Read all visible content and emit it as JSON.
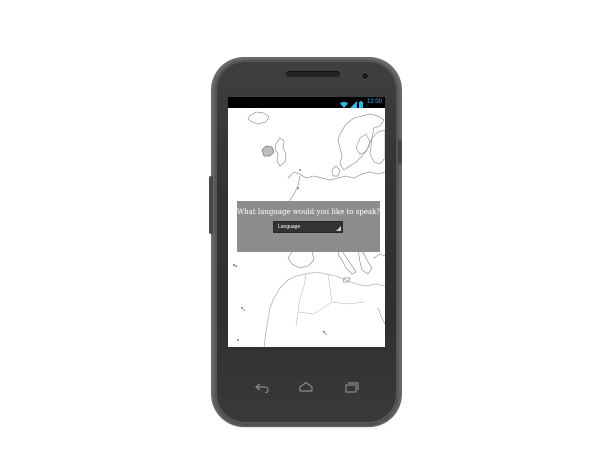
{
  "status_bar": {
    "time": "12:00",
    "icons": [
      "wifi-icon",
      "signal-icon",
      "battery-icon"
    ],
    "accent_color": "#33b5e5"
  },
  "dialog": {
    "prompt": "What language would you like to speak?",
    "select": {
      "selected_value": "Language"
    }
  },
  "nav_bar": {
    "icons": [
      "back-icon",
      "home-icon",
      "recent-apps-icon"
    ]
  },
  "colors": {
    "phone_body": "#333333",
    "dialog_background": "#8a8a8a",
    "select_background": "#2d2d2d",
    "map_lines": "#8c8c8c",
    "nav_icons": "#8a8a8a"
  }
}
